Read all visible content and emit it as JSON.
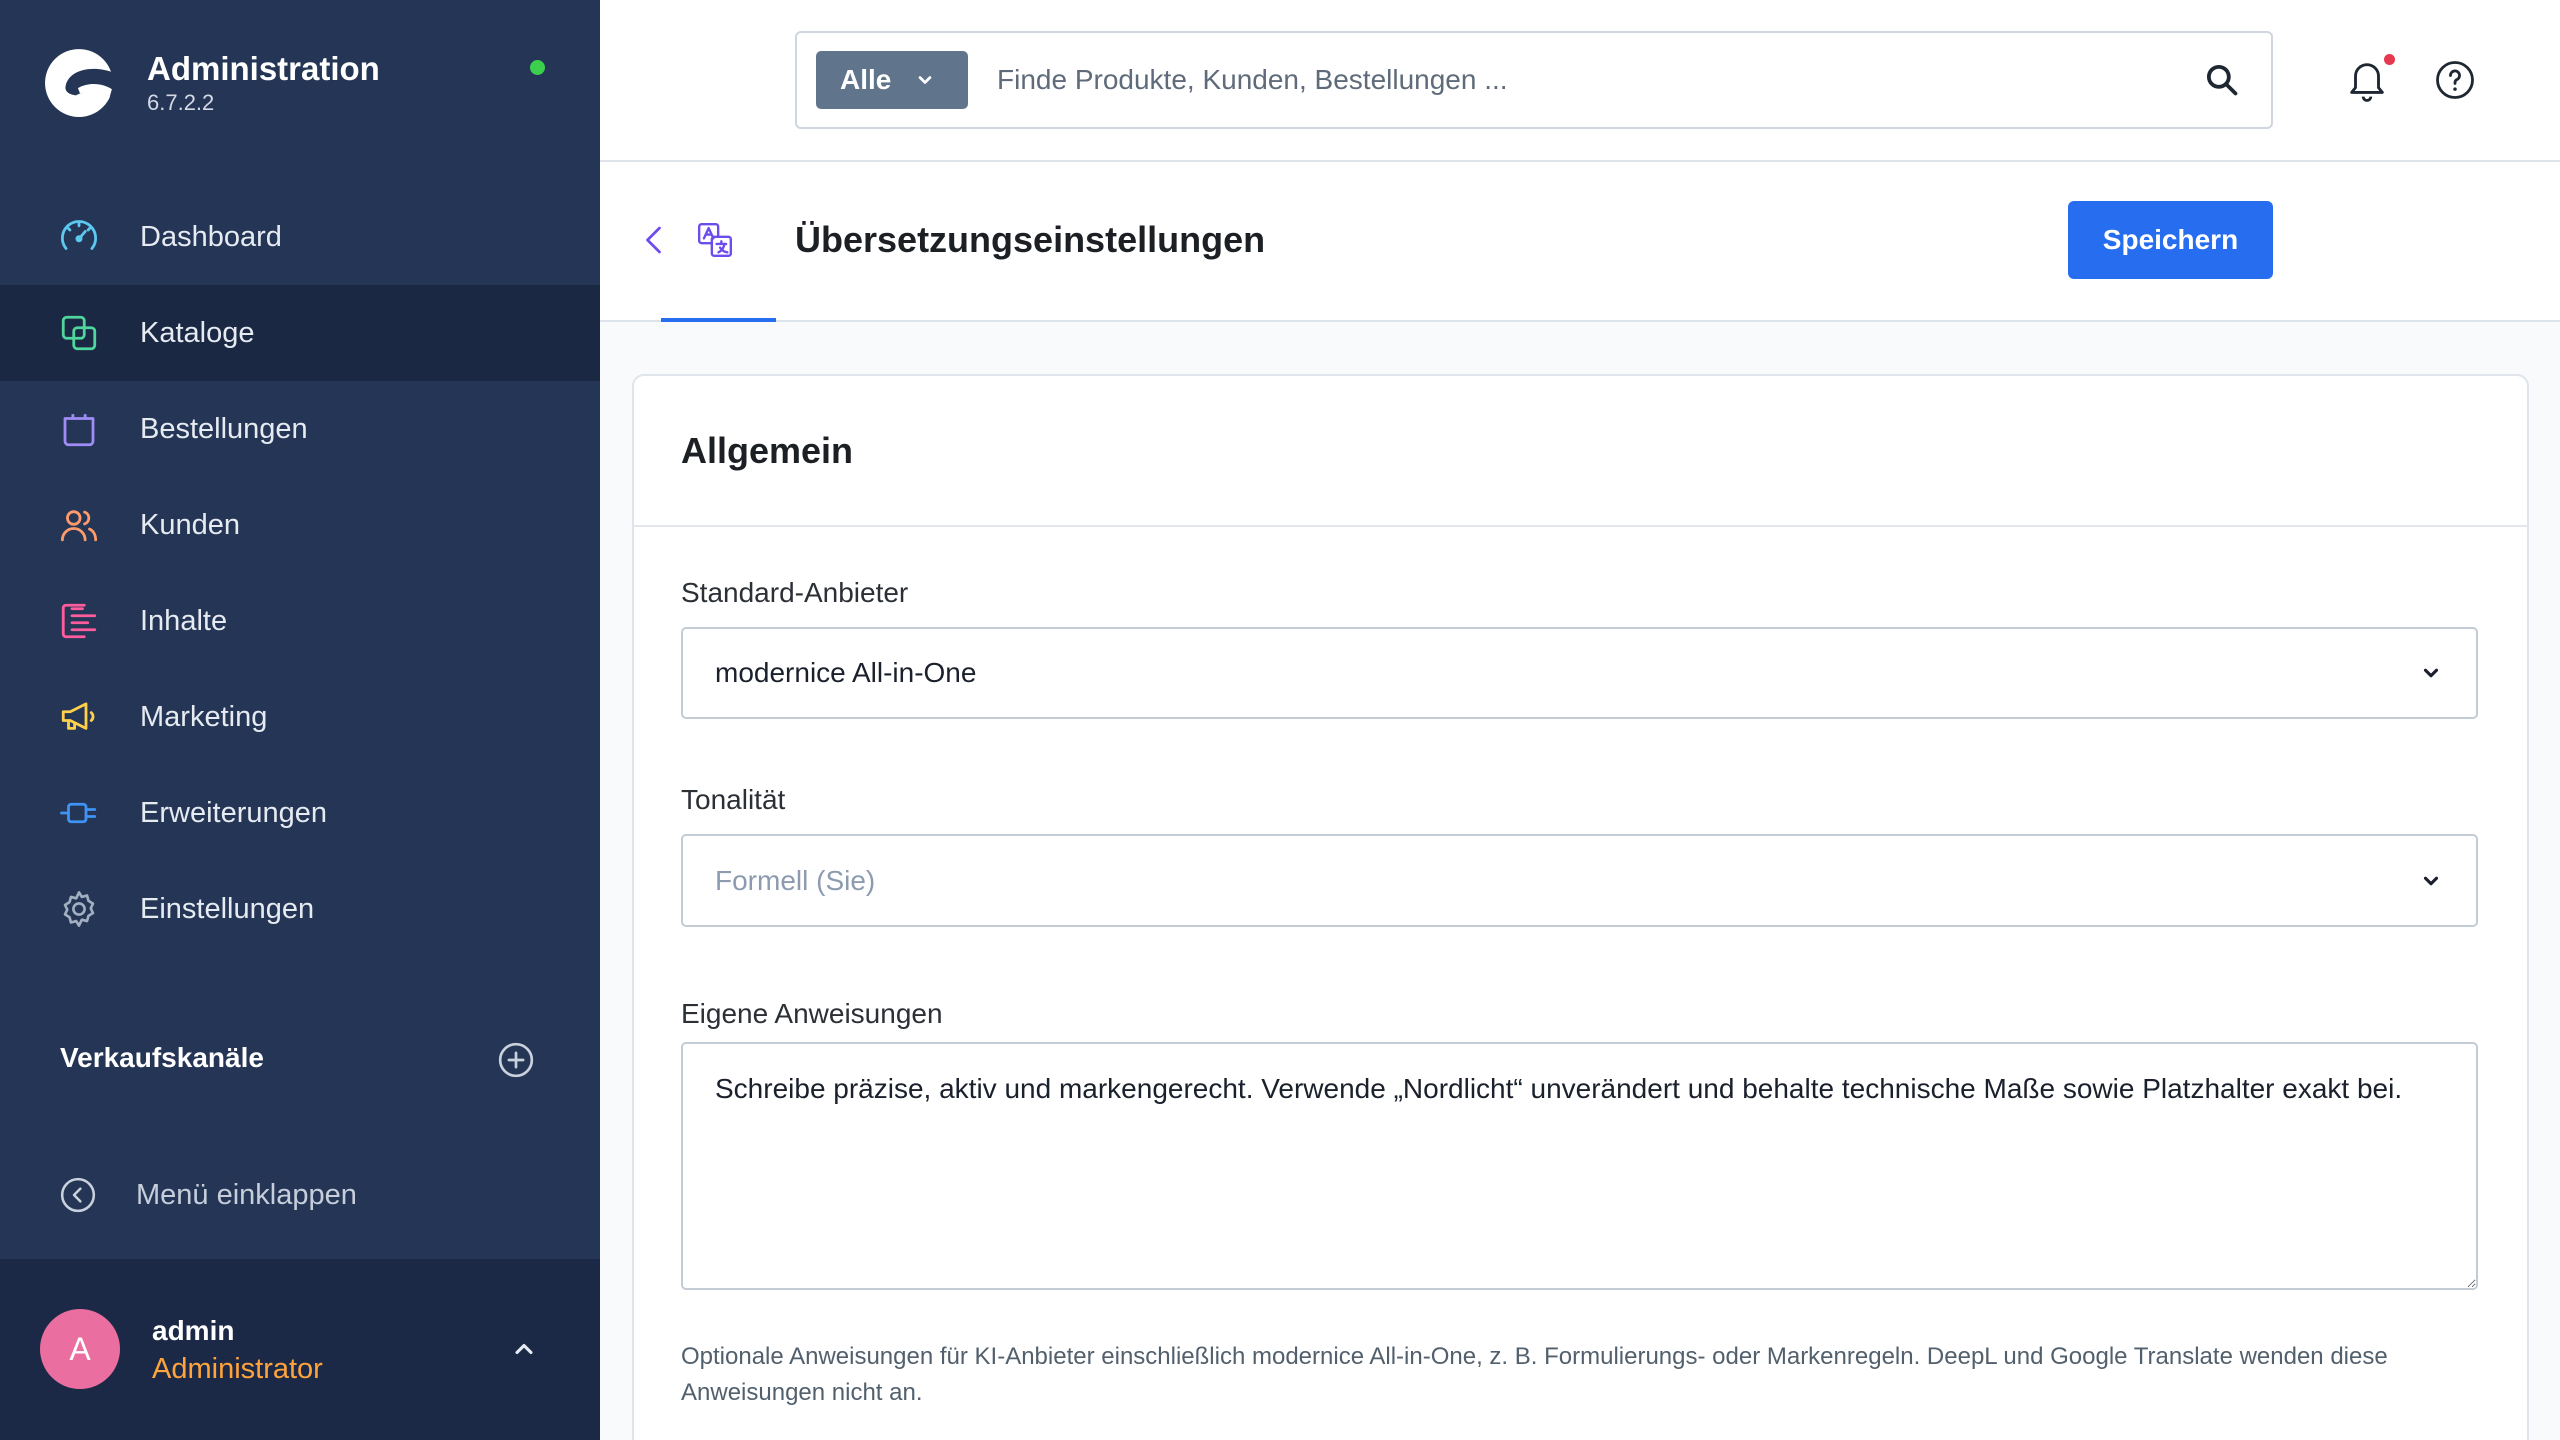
{
  "app": {
    "title": "Administration",
    "version": "6.7.2.2",
    "status_color": "#3ccf4e",
    "logo_icon": "shopware-logo"
  },
  "sidebar": {
    "items": [
      {
        "label": "Dashboard",
        "icon": "dashboard-icon",
        "color": "#5cc8f0",
        "active": false
      },
      {
        "label": "Kataloge",
        "icon": "copy-icon",
        "color": "#4fd69c",
        "active": true
      },
      {
        "label": "Bestellungen",
        "icon": "shopping-bag-icon",
        "color": "#a08cf6",
        "active": false
      },
      {
        "label": "Kunden",
        "icon": "users-icon",
        "color": "#ff9b6a",
        "active": false
      },
      {
        "label": "Inhalte",
        "icon": "content-list-icon",
        "color": "#ff5c9d",
        "active": false
      },
      {
        "label": "Marketing",
        "icon": "megaphone-icon",
        "color": "#ffd04a",
        "active": false
      },
      {
        "label": "Erweiterungen",
        "icon": "plug-icon",
        "color": "#3f93f4",
        "active": false
      },
      {
        "label": "Einstellungen",
        "icon": "gear-icon",
        "color": "#a3afc0",
        "active": false
      }
    ],
    "sales_channels": {
      "heading": "Verkaufskanäle",
      "icon": "plus-circle-icon"
    },
    "collapse": {
      "label": "Menü einklappen",
      "icon": "chevron-left-circle-icon"
    },
    "user": {
      "initial": "A",
      "name": "admin",
      "role": "Administrator",
      "avatar_color": "#ea6fa0",
      "role_color": "#ffa43c",
      "toggle_icon": "chevron-up-icon"
    }
  },
  "header": {
    "search": {
      "filter_label": "Alle",
      "placeholder": "Finde Produkte, Kunden, Bestellungen ...",
      "icon": "search-icon"
    },
    "notifications": {
      "icon": "bell-icon",
      "badge_color": "#e5394f"
    },
    "help": {
      "icon": "help-icon"
    }
  },
  "smart_bar": {
    "title": "Übersetzungseinstellungen",
    "save_label": "Speichern",
    "primary_color": "#266df0",
    "module_color": "#6d4ced",
    "module_icon": "translate-icon"
  },
  "card": {
    "title": "Allgemein",
    "fields": [
      {
        "label": "Standard-Anbieter",
        "value": "modernice All-in-One"
      },
      {
        "label": "Tonalität",
        "placeholder": "Formell (Sie)"
      },
      {
        "label": "Eigene Anweisungen",
        "value": "Schreibe präzise, aktiv und markengerecht. Verwende „Nordlicht“ unverändert und behalte technische Maße sowie Platzhalter exakt bei."
      }
    ],
    "help_text": "Optionale Anweisungen für KI-Anbieter einschließlich modernice All-in-One, z. B. Formulierungs- oder Markenregeln. DeepL und Google Translate wenden diese Anweisungen nicht an."
  }
}
